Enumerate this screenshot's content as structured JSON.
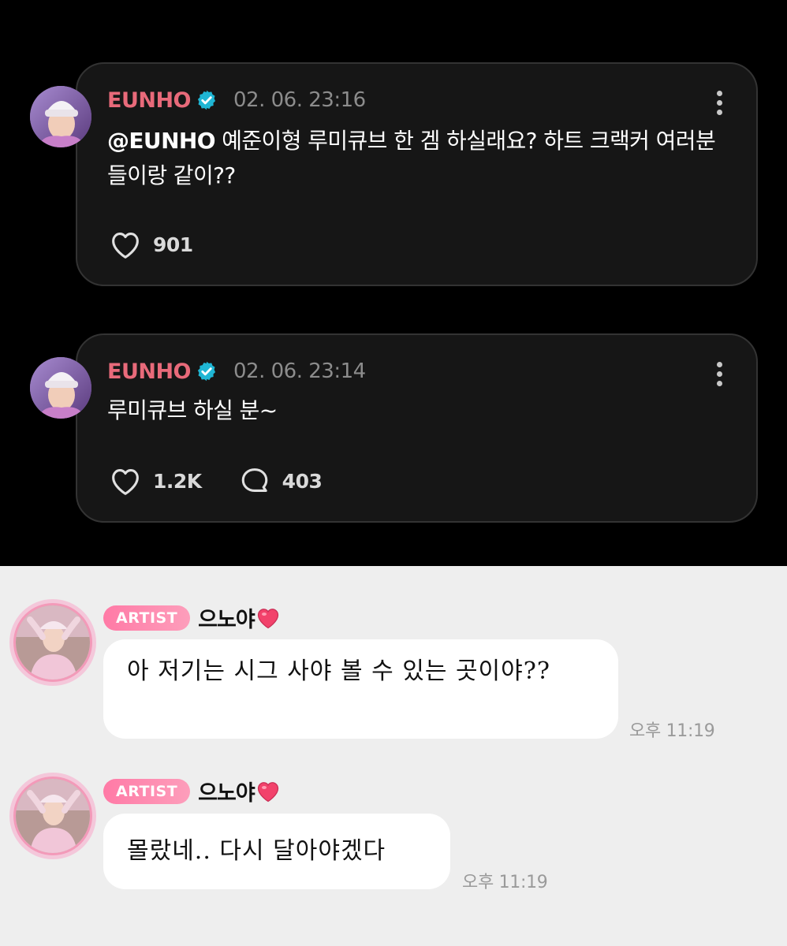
{
  "colors": {
    "brand_name": "#e86a7a",
    "verified": "#1fb6d4",
    "artist_badge": "#ff7aa6",
    "heart_emoji": "#f2426b"
  },
  "posts": [
    {
      "author": "EUNHO",
      "verified_icon": "verified-check-icon",
      "timestamp": "02. 06. 23:16",
      "mention": "@EUNHO",
      "text": " 예준이형 루미큐브 한 겜 하실래요? 하트 크랙커 여러분들이랑 같이??",
      "likes": "901"
    },
    {
      "author": "EUNHO",
      "verified_icon": "verified-check-icon",
      "timestamp": "02. 06. 23:14",
      "mention": "",
      "text": "루미큐브 하실 분~",
      "likes": "1.2K",
      "comments": "403"
    }
  ],
  "chat": [
    {
      "badge": "ARTIST",
      "name": "으노야",
      "message": "아 저기는 시그 사야 볼 수 있는 곳이야??",
      "time": "오후 11:19"
    },
    {
      "badge": "ARTIST",
      "name": "으노야",
      "message": "몰랐네.. 다시 달아야겠다",
      "time": "오후 11:19"
    }
  ]
}
